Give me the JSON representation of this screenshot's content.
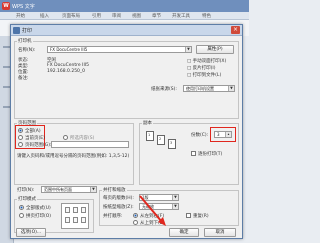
{
  "app": {
    "logo_text": "W",
    "title": "WPS 文字",
    "tabs": [
      "开始",
      "插入",
      "页面布局",
      "引用",
      "审阅",
      "视图",
      "章节",
      "开发工具",
      "特色"
    ]
  },
  "dialog": {
    "title": "打印",
    "printer": {
      "group_label": "打印机",
      "name_label": "名称(N):",
      "name_value": "FX DocuCentre III5",
      "status_label": "状态:",
      "status_value": "空闲",
      "type_label": "类型:",
      "type_value": "FX DocuCentre III5",
      "where_label": "位置:",
      "where_value": "192.168.0.250_0",
      "comment_label": "备注:",
      "properties_button": "属性(P)",
      "find_printer_checkbox": "□ 手动双面打印(X)",
      "reverse_checkbox": "□ 反片打印(I)",
      "to_file_checkbox": "□ 打印到文件(L)",
      "paper_source_label": "纸张来源(S):",
      "paper_source_value": "使用打印机设置"
    },
    "page_range": {
      "group_label": "页码范围",
      "all": "全部(A)",
      "current": "当前页(E)",
      "selection": "所选内容(S)",
      "pages": "页码范围(G):",
      "hint": "请键入页码和/或用逗号分隔的页码范围(例如: 1,3,5-12)"
    },
    "copies": {
      "group_label": "副本",
      "count_label": "份数(C):",
      "count_value": "3",
      "collate_label": "逐份打印(T)"
    },
    "print_what": {
      "label": "打印(N):",
      "value": "范围中所有页面"
    },
    "print_mode": {
      "label": "打印模式",
      "option1": "全部版式(U)",
      "option2": "拼页打印(O)"
    },
    "zoom": {
      "group_label": "并打和缩放",
      "pages_per_sheet_label": "每页的版数(H):",
      "pages_per_sheet_value": "1版",
      "scale_label": "按纸型缩放(Z):",
      "scale_value": "无缩放",
      "order_label": "并打顺序:",
      "order_left_right": "从左到右(F)",
      "order_top_bottom": "从上到下(B)",
      "repeat": "重复(R)"
    },
    "options_button": "选项(O)...",
    "ok_button": "确定",
    "cancel_button": "取消",
    "page_icon_labels": [
      "1",
      "2",
      "3"
    ]
  }
}
